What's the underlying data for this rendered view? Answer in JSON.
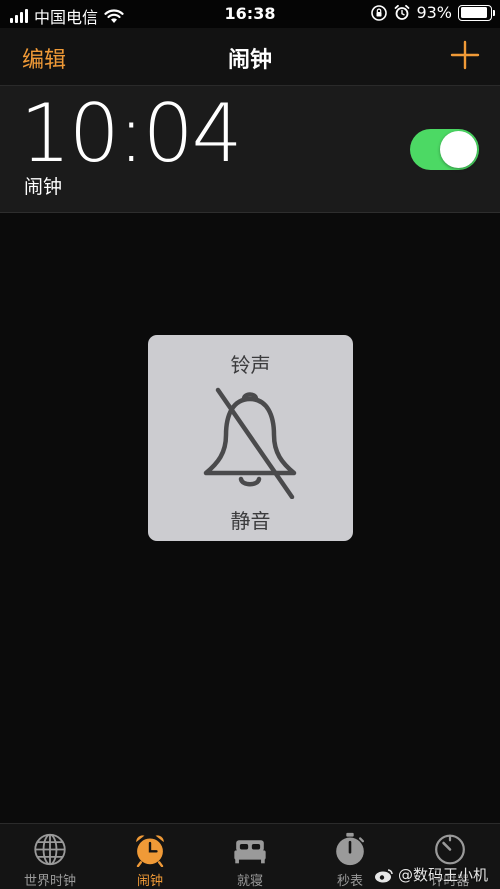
{
  "status_bar": {
    "carrier": "中国电信",
    "time": "16:38",
    "battery_percent": "93%",
    "battery_level": 0.93
  },
  "nav": {
    "edit_label": "编辑",
    "title": "闹钟"
  },
  "alarm": {
    "time": "10:04",
    "label": "闹钟",
    "enabled": true
  },
  "ringer_hud": {
    "title": "铃声",
    "status": "静音"
  },
  "tabs": [
    {
      "label": "世界时钟",
      "icon": "globe-icon"
    },
    {
      "label": "闹钟",
      "icon": "alarm-clock-icon",
      "active": true
    },
    {
      "label": "就寝",
      "icon": "bed-icon"
    },
    {
      "label": "秒表",
      "icon": "stopwatch-icon"
    },
    {
      "label": "计时器",
      "icon": "timer-icon"
    }
  ],
  "watermark": {
    "text": "@数码王小机"
  },
  "colors": {
    "accent": "#f09a37",
    "toggle_on": "#4cd964",
    "hud_background": "#ccccd0"
  }
}
